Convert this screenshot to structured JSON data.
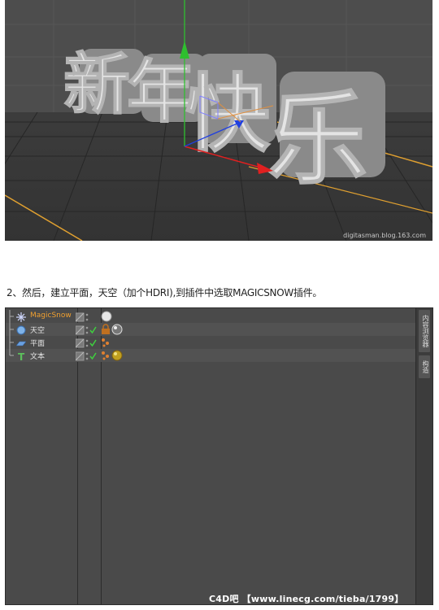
{
  "viewport": {
    "text3d": [
      "新",
      "年",
      "快",
      "乐"
    ],
    "watermark": "digitasman.blog.163.com"
  },
  "step_text": "2、然后，建立平面，天空（加个HDRI),到插件中选取MAGICSNOW插件。",
  "object_manager": {
    "rows": [
      {
        "name": "MagicSnow",
        "icon": "snowflake-icon",
        "active": true
      },
      {
        "name": "天空",
        "icon": "sky-sphere-icon",
        "active": false
      },
      {
        "name": "平面",
        "icon": "plane-icon",
        "active": false
      },
      {
        "name": "文本",
        "icon": "text-t-icon",
        "active": false
      }
    ],
    "side_tabs": [
      "内容浏览器",
      "构造"
    ],
    "footer": "C4D吧 【www.linecg.com/tieba/1799】"
  },
  "colors": {
    "viewport_bg": "#4d4d4d",
    "floor": "#3a3a3a",
    "grid": "#262626",
    "horizon": "#e0a030",
    "axis_y": "#2fbf2f",
    "axis_x": "#e02020",
    "axis_z": "#2040e0",
    "active_object": "#f0a030"
  }
}
